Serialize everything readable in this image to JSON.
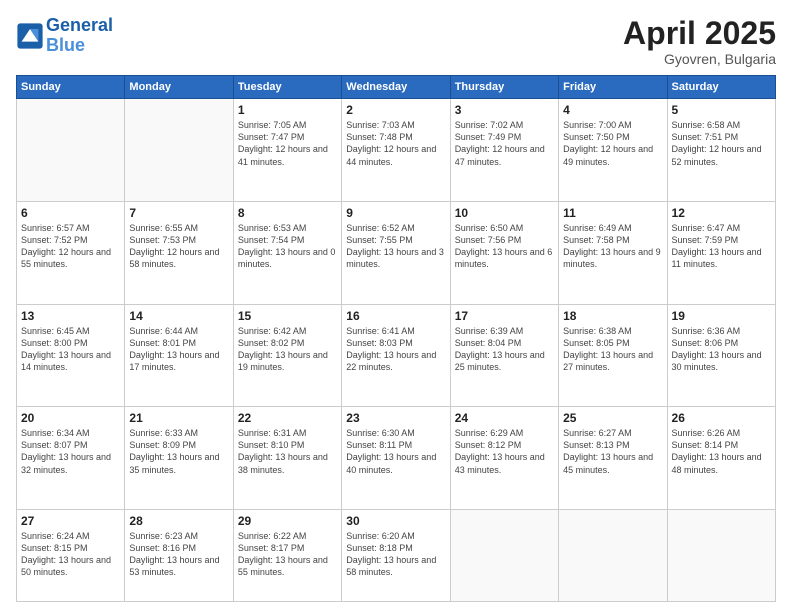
{
  "header": {
    "logo": {
      "line1": "General",
      "line2": "Blue"
    },
    "title": "April 2025",
    "subtitle": "Gyovren, Bulgaria"
  },
  "weekdays": [
    "Sunday",
    "Monday",
    "Tuesday",
    "Wednesday",
    "Thursday",
    "Friday",
    "Saturday"
  ],
  "weeks": [
    [
      {
        "day": "",
        "info": ""
      },
      {
        "day": "",
        "info": ""
      },
      {
        "day": "1",
        "info": "Sunrise: 7:05 AM\nSunset: 7:47 PM\nDaylight: 12 hours and 41 minutes."
      },
      {
        "day": "2",
        "info": "Sunrise: 7:03 AM\nSunset: 7:48 PM\nDaylight: 12 hours and 44 minutes."
      },
      {
        "day": "3",
        "info": "Sunrise: 7:02 AM\nSunset: 7:49 PM\nDaylight: 12 hours and 47 minutes."
      },
      {
        "day": "4",
        "info": "Sunrise: 7:00 AM\nSunset: 7:50 PM\nDaylight: 12 hours and 49 minutes."
      },
      {
        "day": "5",
        "info": "Sunrise: 6:58 AM\nSunset: 7:51 PM\nDaylight: 12 hours and 52 minutes."
      }
    ],
    [
      {
        "day": "6",
        "info": "Sunrise: 6:57 AM\nSunset: 7:52 PM\nDaylight: 12 hours and 55 minutes."
      },
      {
        "day": "7",
        "info": "Sunrise: 6:55 AM\nSunset: 7:53 PM\nDaylight: 12 hours and 58 minutes."
      },
      {
        "day": "8",
        "info": "Sunrise: 6:53 AM\nSunset: 7:54 PM\nDaylight: 13 hours and 0 minutes."
      },
      {
        "day": "9",
        "info": "Sunrise: 6:52 AM\nSunset: 7:55 PM\nDaylight: 13 hours and 3 minutes."
      },
      {
        "day": "10",
        "info": "Sunrise: 6:50 AM\nSunset: 7:56 PM\nDaylight: 13 hours and 6 minutes."
      },
      {
        "day": "11",
        "info": "Sunrise: 6:49 AM\nSunset: 7:58 PM\nDaylight: 13 hours and 9 minutes."
      },
      {
        "day": "12",
        "info": "Sunrise: 6:47 AM\nSunset: 7:59 PM\nDaylight: 13 hours and 11 minutes."
      }
    ],
    [
      {
        "day": "13",
        "info": "Sunrise: 6:45 AM\nSunset: 8:00 PM\nDaylight: 13 hours and 14 minutes."
      },
      {
        "day": "14",
        "info": "Sunrise: 6:44 AM\nSunset: 8:01 PM\nDaylight: 13 hours and 17 minutes."
      },
      {
        "day": "15",
        "info": "Sunrise: 6:42 AM\nSunset: 8:02 PM\nDaylight: 13 hours and 19 minutes."
      },
      {
        "day": "16",
        "info": "Sunrise: 6:41 AM\nSunset: 8:03 PM\nDaylight: 13 hours and 22 minutes."
      },
      {
        "day": "17",
        "info": "Sunrise: 6:39 AM\nSunset: 8:04 PM\nDaylight: 13 hours and 25 minutes."
      },
      {
        "day": "18",
        "info": "Sunrise: 6:38 AM\nSunset: 8:05 PM\nDaylight: 13 hours and 27 minutes."
      },
      {
        "day": "19",
        "info": "Sunrise: 6:36 AM\nSunset: 8:06 PM\nDaylight: 13 hours and 30 minutes."
      }
    ],
    [
      {
        "day": "20",
        "info": "Sunrise: 6:34 AM\nSunset: 8:07 PM\nDaylight: 13 hours and 32 minutes."
      },
      {
        "day": "21",
        "info": "Sunrise: 6:33 AM\nSunset: 8:09 PM\nDaylight: 13 hours and 35 minutes."
      },
      {
        "day": "22",
        "info": "Sunrise: 6:31 AM\nSunset: 8:10 PM\nDaylight: 13 hours and 38 minutes."
      },
      {
        "day": "23",
        "info": "Sunrise: 6:30 AM\nSunset: 8:11 PM\nDaylight: 13 hours and 40 minutes."
      },
      {
        "day": "24",
        "info": "Sunrise: 6:29 AM\nSunset: 8:12 PM\nDaylight: 13 hours and 43 minutes."
      },
      {
        "day": "25",
        "info": "Sunrise: 6:27 AM\nSunset: 8:13 PM\nDaylight: 13 hours and 45 minutes."
      },
      {
        "day": "26",
        "info": "Sunrise: 6:26 AM\nSunset: 8:14 PM\nDaylight: 13 hours and 48 minutes."
      }
    ],
    [
      {
        "day": "27",
        "info": "Sunrise: 6:24 AM\nSunset: 8:15 PM\nDaylight: 13 hours and 50 minutes."
      },
      {
        "day": "28",
        "info": "Sunrise: 6:23 AM\nSunset: 8:16 PM\nDaylight: 13 hours and 53 minutes."
      },
      {
        "day": "29",
        "info": "Sunrise: 6:22 AM\nSunset: 8:17 PM\nDaylight: 13 hours and 55 minutes."
      },
      {
        "day": "30",
        "info": "Sunrise: 6:20 AM\nSunset: 8:18 PM\nDaylight: 13 hours and 58 minutes."
      },
      {
        "day": "",
        "info": ""
      },
      {
        "day": "",
        "info": ""
      },
      {
        "day": "",
        "info": ""
      }
    ]
  ]
}
